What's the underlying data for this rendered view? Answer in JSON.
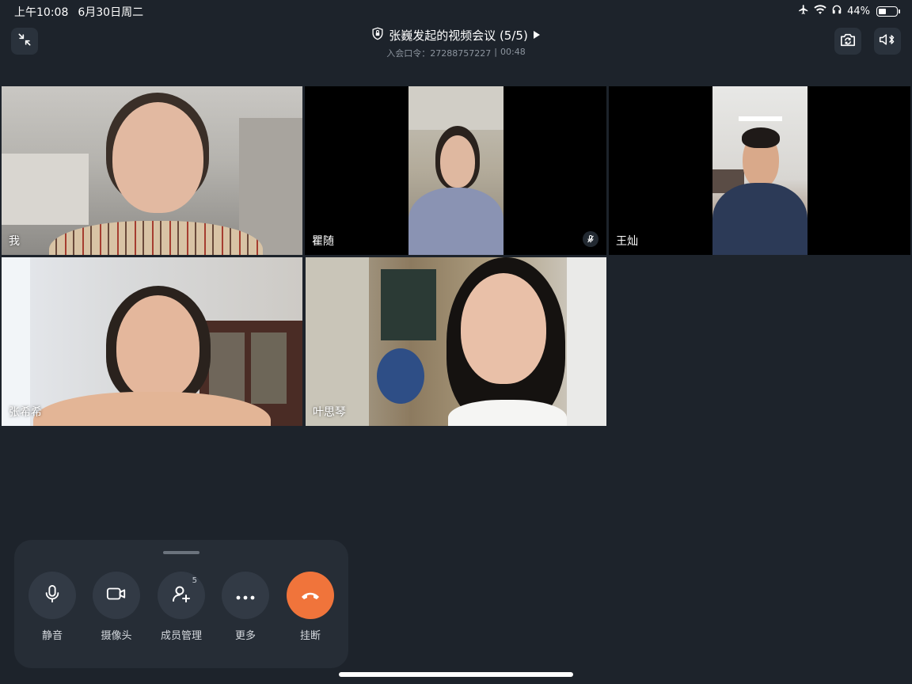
{
  "status": {
    "time": "上午10:08",
    "date": "6月30日周二",
    "battery_text": "44%",
    "battery_level": 0.44
  },
  "header": {
    "title": "张巍发起的视频会议 (5/5)",
    "meeting_code_label": "入会口令：",
    "meeting_code": "27288757227",
    "separator": "|",
    "duration": "00:48",
    "icons": {
      "minimize": "shrink-arrows-icon",
      "lock": "shield-lock-icon",
      "expand": "play-triangle-icon",
      "camera_switch": "camera-flip-icon",
      "audio_output": "speaker-bluetooth-icon"
    }
  },
  "participants": [
    {
      "name": "我",
      "muted": false
    },
    {
      "name": "瞿随",
      "muted": true
    },
    {
      "name": "王灿",
      "muted": false
    },
    {
      "name": "张希希",
      "muted": false
    },
    {
      "name": "叶思琴",
      "muted": false
    }
  ],
  "controls": {
    "mute": {
      "label": "静音",
      "icon": "microphone-icon"
    },
    "camera": {
      "label": "摄像头",
      "icon": "video-camera-icon"
    },
    "members": {
      "label": "成员管理",
      "icon": "add-member-icon",
      "count": "5"
    },
    "more": {
      "label": "更多",
      "icon": "more-dots-icon"
    },
    "hangup": {
      "label": "挂断",
      "icon": "hangup-phone-icon"
    }
  },
  "colors": {
    "background": "#1d232b",
    "panel": "#262d36",
    "button": "#323a45",
    "hangup": "#f0743b"
  }
}
